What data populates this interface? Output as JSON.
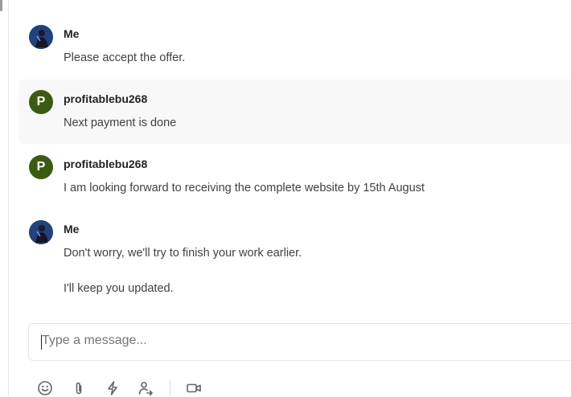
{
  "messages": [
    {
      "sender": "Me",
      "text": [
        "Please accept the offer."
      ],
      "avatar": {
        "type": "photo",
        "icon": "user-photo-icon"
      },
      "highlighted": false
    },
    {
      "sender": "profitablebu268",
      "text": [
        "Next payment is done"
      ],
      "avatar": {
        "type": "letter",
        "letter": "P"
      },
      "highlighted": true
    },
    {
      "sender": "profitablebu268",
      "text": [
        "I am looking forward to receiving the complete website by 15th August"
      ],
      "avatar": {
        "type": "letter",
        "letter": "P"
      },
      "highlighted": false
    },
    {
      "sender": "Me",
      "text": [
        "Don't worry, we'll try to finish your work earlier.",
        "I'll keep you updated."
      ],
      "avatar": {
        "type": "photo",
        "icon": "user-photo-icon"
      },
      "highlighted": false
    }
  ],
  "composer": {
    "placeholder": "Type a message..."
  },
  "toolbar": {
    "icons": [
      "emoji-icon",
      "attachment-icon",
      "lightning-icon",
      "user-share-icon",
      "video-icon"
    ]
  },
  "colors": {
    "avatar_letter_bg": "#3d5a12",
    "highlight_bg": "#f8f8f8",
    "text": "#404145"
  }
}
